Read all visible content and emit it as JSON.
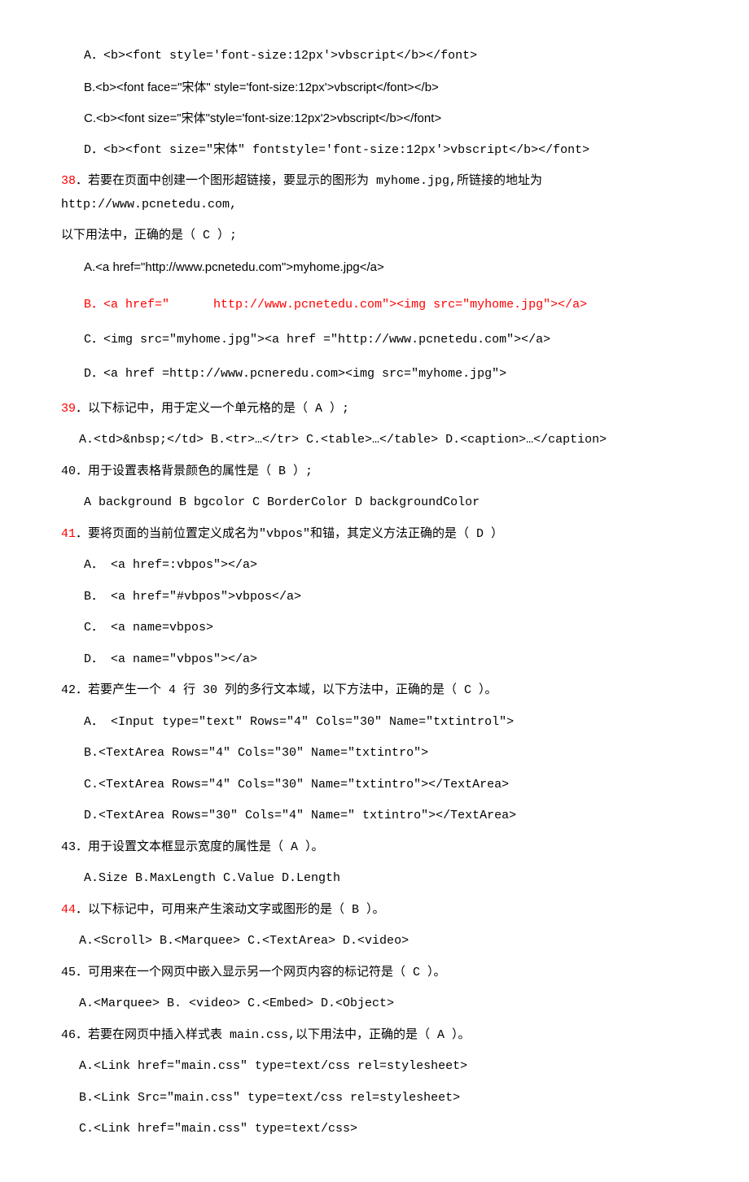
{
  "l1": "A．<b><font style='font-size:12px'>vbscript</b></font>",
  "l2": "B.<b><font face=\"宋体\" style='font-size:12px'>vbscript</font></b>",
  "l3": "C.<b><font size=\"宋体\"style='font-size:12px'2>vbscript</b></font>",
  "l4": "D．<b><font size=\"宋体\" fontstyle='font-size:12px'>vbscript</b></font>",
  "l5a": "38",
  "l5b": "．若要在页面中创建一个图形超链接，要显示的图形为 myhome.jpg,所链接的地址为 http://www.pcnetedu.com,",
  "l6": "以下用法中，正确的是（  C  ）;",
  "l7": "A.<a href=\"http://www.pcnetedu.com\">myhome.jpg</a>",
  "l8a": "B．<a href=\"",
  "l8b": "http://www.pcnetedu.com\"><img  src=\"myhome.jpg\"></a>",
  "l9": "C．<img src=\"myhome.jpg\"><a href =\"http://www.pcnetedu.com\"></a>",
  "l10": "D．<a href =http://www.pcneredu.com><img src=\"myhome.jpg\">",
  "l11a": "39",
  "l11b": "．以下标记中，用于定义一个单元格的是（ A   ）;",
  "l12": "A.<td>&nbsp;</td>   B.<tr>…</tr>   C.<table>…</table>   D.<caption>…</caption>",
  "l13": "40．用于设置表格背景颜色的属性是（  B   ）;",
  "l14": "A   background    B bgcolor    C BorderColor     D backgroundColor",
  "l15a": "41",
  "l15b": "．要将页面的当前位置定义成名为\"vbpos\"和锚，其定义方法正确的是（ D   ）",
  "l16": "A． <a href=:vbpos\"></a>",
  "l17": "B． <a href=\"#vbpos\">vbpos</a>",
  "l18": "C． <a name=vbpos>",
  "l19": "D． <a name=\"vbpos\"></a>",
  "l20": "42．若要产生一个 4 行 30 列的多行文本域，以下方法中，正确的是（  C  ）。",
  "l21": "A． <Input type=\"text\" Rows=\"4\" Cols=\"30\" Name=\"txtintrol\">",
  "l22": "B.<TextArea Rows=\"4\" Cols=\"30\" Name=\"txtintro\">",
  "l23": "C.<TextArea Rows=\"4\" Cols=\"30\" Name=\"txtintro\"></TextArea>",
  "l24": "D.<TextArea Rows=\"30\" Cols=\"4\" Name=\"              txtintro\"></TextArea>",
  "l25": "43．用于设置文本框显示宽度的属性是（ A ）。",
  "l26": "A.Size        B.MaxLength    C.Value    D.Length",
  "l27a": "44",
  "l27b": "．以下标记中，可用来产生滚动文字或图形的是（  B ）。",
  "l28": "A.<Scroll>    B.<Marquee>   C.<TextArea>   D.<video>",
  "l29": "45．可用来在一个网页中嵌入显示另一个网页内容的标记符是（ C  ）。",
  "l30": "A.<Marquee>   B. <video>   C.<Embed>    D.<Object>",
  "l31": "46．若要在网页中插入样式表 main.css,以下用法中，正确的是（ A  ）。",
  "l32": "A.<Link href=\"main.css\"  type=text/css rel=stylesheet>",
  "l33": "B.<Link Src=\"main.css\"  type=text/css rel=stylesheet>",
  "l34": "C.<Link href=\"main.css\"  type=text/css>"
}
